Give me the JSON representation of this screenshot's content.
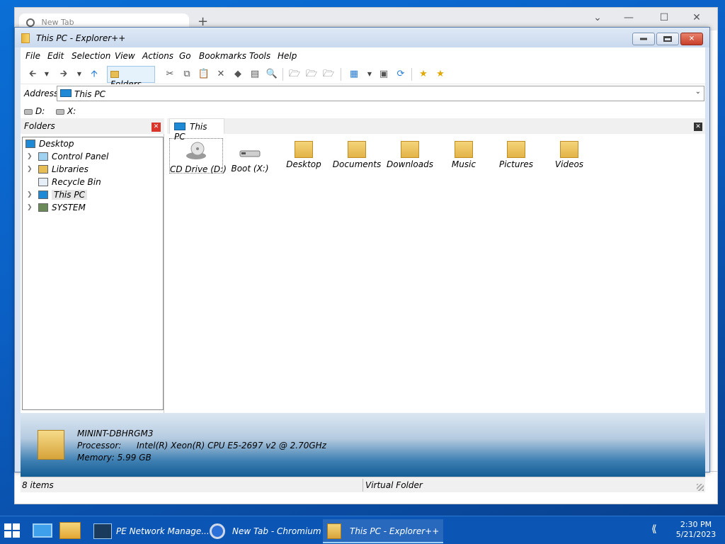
{
  "browser": {
    "tab_title": "New Tab"
  },
  "window": {
    "title": "This PC - Explorer++"
  },
  "menu": {
    "items": [
      "File",
      "Edit",
      "Selection",
      "View",
      "Actions",
      "Go",
      "Bookmarks",
      "Tools",
      "Help"
    ]
  },
  "toolbar": {
    "folders_label": "Folders"
  },
  "address": {
    "label": "Address",
    "value": "This PC"
  },
  "drives": [
    {
      "label": "D:"
    },
    {
      "label": "X:"
    }
  ],
  "folders_panel": {
    "title": "Folders",
    "tree": [
      {
        "label": "Desktop"
      },
      {
        "label": "Control Panel"
      },
      {
        "label": "Libraries"
      },
      {
        "label": "Recycle Bin"
      },
      {
        "label": "This PC"
      },
      {
        "label": "SYSTEM"
      }
    ]
  },
  "tab": {
    "label": "This PC"
  },
  "items": [
    {
      "label": "CD Drive (D:)",
      "icon": "cd-drive-icon"
    },
    {
      "label": "Boot (X:)",
      "icon": "drive-icon"
    },
    {
      "label": "Desktop",
      "icon": "folder-desktop-icon"
    },
    {
      "label": "Documents",
      "icon": "folder-documents-icon"
    },
    {
      "label": "Downloads",
      "icon": "folder-downloads-icon"
    },
    {
      "label": "Music",
      "icon": "folder-music-icon"
    },
    {
      "label": "Pictures",
      "icon": "folder-pictures-icon"
    },
    {
      "label": "Videos",
      "icon": "folder-videos-icon"
    }
  ],
  "info_panel": {
    "computer_name": "MININT-DBHRGM3",
    "processor_label": "Processor:",
    "processor_value": "Intel(R) Xeon(R) CPU E5-2697 v2 @ 2.70GHz",
    "memory": "Memory: 5.99 GB"
  },
  "status": {
    "item_count": "8 items",
    "location_type": "Virtual Folder"
  },
  "taskbar": {
    "tasks": [
      {
        "label": "PE Network Manage..."
      },
      {
        "label": "New Tab - Chromium"
      },
      {
        "label": "This PC - Explorer++"
      }
    ],
    "time": "2:30 PM",
    "date": "5/21/2023"
  },
  "colors": {
    "desktop": "#0b5fc4",
    "taskbar": "#0b55b5",
    "window_border": "#5a7fae",
    "close_button": "#c8402a"
  }
}
